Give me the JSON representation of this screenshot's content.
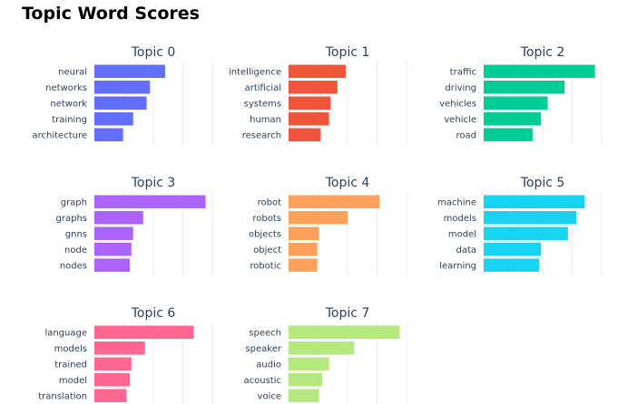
{
  "title": "Topic Word Scores",
  "chart_data": {
    "type": "bar",
    "orientation": "horizontal",
    "title": "Topic Word Scores",
    "grid": true,
    "subplots": [
      {
        "title": "Topic 0",
        "color": "#636efa",
        "words": [
          "neural",
          "networks",
          "network",
          "training",
          "architecture"
        ],
        "values": [
          0.042,
          0.033,
          0.031,
          0.023,
          0.017
        ]
      },
      {
        "title": "Topic 1",
        "color": "#ef553b",
        "words": [
          "intelligence",
          "artificial",
          "systems",
          "human",
          "research"
        ],
        "values": [
          0.034,
          0.029,
          0.025,
          0.024,
          0.019
        ]
      },
      {
        "title": "Topic 2",
        "color": "#00cc96",
        "words": [
          "traffic",
          "driving",
          "vehicles",
          "vehicle",
          "road"
        ],
        "values": [
          0.066,
          0.048,
          0.038,
          0.034,
          0.029
        ]
      },
      {
        "title": "Topic 3",
        "color": "#ab63fa",
        "words": [
          "graph",
          "graphs",
          "gnns",
          "node",
          "nodes"
        ],
        "values": [
          0.066,
          0.029,
          0.023,
          0.022,
          0.021
        ]
      },
      {
        "title": "Topic 4",
        "color": "#ffa15a",
        "words": [
          "robot",
          "robots",
          "objects",
          "object",
          "robotic"
        ],
        "values": [
          0.054,
          0.035,
          0.018,
          0.017,
          0.017
        ]
      },
      {
        "title": "Topic 5",
        "color": "#19d3f3",
        "words": [
          "machine",
          "models",
          "model",
          "data",
          "learning"
        ],
        "values": [
          0.06,
          0.055,
          0.05,
          0.034,
          0.033
        ]
      },
      {
        "title": "Topic 6",
        "color": "#ff6692",
        "words": [
          "language",
          "models",
          "trained",
          "model",
          "translation"
        ],
        "values": [
          0.059,
          0.03,
          0.022,
          0.021,
          0.019
        ]
      },
      {
        "title": "Topic 7",
        "color": "#b6e880",
        "words": [
          "speech",
          "speaker",
          "audio",
          "acoustic",
          "voice"
        ],
        "values": [
          0.066,
          0.039,
          0.024,
          0.02,
          0.018
        ]
      }
    ]
  }
}
